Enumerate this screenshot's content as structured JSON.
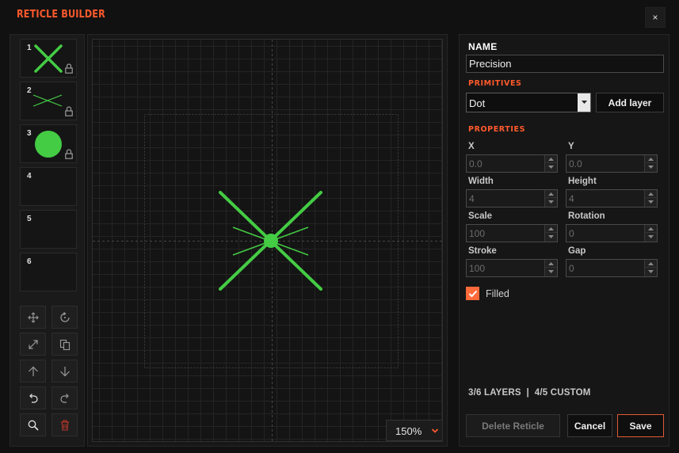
{
  "app": {
    "title": "RETICLE BUILDER",
    "close_label": "×"
  },
  "layers": [
    {
      "number": "1",
      "shape": "x",
      "locked": true
    },
    {
      "number": "2",
      "shape": "thin-x",
      "locked": true
    },
    {
      "number": "3",
      "shape": "dot",
      "locked": true
    },
    {
      "number": "4",
      "shape": "empty",
      "locked": false
    },
    {
      "number": "5",
      "shape": "empty",
      "locked": false
    },
    {
      "number": "6",
      "shape": "empty",
      "locked": false
    }
  ],
  "tools": [
    {
      "name": "move-tool",
      "icon": "move-icon"
    },
    {
      "name": "rotate-tool",
      "icon": "rotate-icon"
    },
    {
      "name": "resize-tool",
      "icon": "resize-icon"
    },
    {
      "name": "duplicate-tool",
      "icon": "duplicate-icon"
    },
    {
      "name": "move-up-tool",
      "icon": "arrow-up-icon"
    },
    {
      "name": "move-down-tool",
      "icon": "arrow-down-icon"
    },
    {
      "name": "undo-tool",
      "icon": "undo-icon"
    },
    {
      "name": "redo-tool",
      "icon": "redo-icon"
    },
    {
      "name": "zoom-tool",
      "icon": "search-icon"
    },
    {
      "name": "delete-tool",
      "icon": "trash-icon"
    }
  ],
  "canvas": {
    "zoom": "150%",
    "reticle_color": "#44cc44"
  },
  "editor": {
    "name_label": "NAME",
    "name_value": "Precision",
    "primitives_label": "PRIMITIVES",
    "primitive_selected": "Dot",
    "add_layer_label": "Add layer",
    "properties_label": "PROPERTIES",
    "properties": {
      "x": {
        "label": "X",
        "value": "0.0"
      },
      "y": {
        "label": "Y",
        "value": "0.0"
      },
      "width": {
        "label": "Width",
        "value": "4"
      },
      "height": {
        "label": "Height",
        "value": "4"
      },
      "scale": {
        "label": "Scale",
        "value": "100"
      },
      "rotation": {
        "label": "Rotation",
        "value": "0"
      },
      "stroke": {
        "label": "Stroke",
        "value": "100"
      },
      "gap": {
        "label": "Gap",
        "value": "0"
      }
    },
    "filled_label": "Filled",
    "filled_checked": true,
    "stats": "3/6 LAYERS  |  4/5 CUSTOM",
    "delete_label": "Delete Reticle",
    "cancel_label": "Cancel",
    "save_label": "Save"
  },
  "colors": {
    "accent": "#ff5a2c",
    "reticle": "#44cc44"
  }
}
